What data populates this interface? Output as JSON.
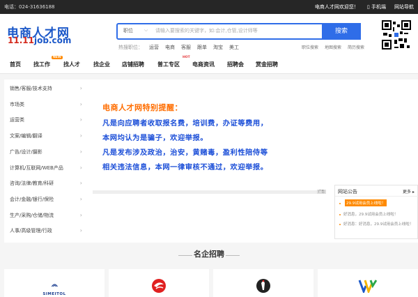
{
  "topbar": {
    "phone": "电话：024-31636188",
    "welcome": "电商人才网欢迎您！",
    "mobile": "手机端",
    "site_nav": "网站导航"
  },
  "logo": {
    "cn": "电商人才网",
    "en_red": "11.11",
    "en_blue": "job.com"
  },
  "search": {
    "type": "职位",
    "placeholder": "请输入要搜索的关键字，如:会计,仓管,设计师等",
    "button": "搜索"
  },
  "hot": {
    "label": "热搜职位：",
    "items": [
      "运营",
      "电商",
      "客服",
      "跟单",
      "淘宝",
      "美工"
    ]
  },
  "sublinks": [
    "职位搜索",
    "地图搜索",
    "简历搜索"
  ],
  "nav": {
    "items": [
      "首页",
      "找工作",
      "找人才",
      "找企业",
      "店铺招聘",
      "普工专区",
      "电商资讯",
      "招聘会",
      "赏金招聘"
    ],
    "badge_new": "NEW",
    "badge_hot": "HOT"
  },
  "categories": [
    "销售/客服/技术支持",
    "市场类",
    "运营类",
    "文案/编辑/翻译",
    "广告/设计/摄影",
    "计算机/互联网/WEB产品",
    "咨询/法律/教育/科研",
    "会计/金融/银行/保险",
    "生产/采购/仓储/物流",
    "人事/高级管理/行政"
  ],
  "notice": {
    "title": "电商人才网特别提醒：",
    "lines": [
      "凡是向应聘者收取报名费，培训费，办证等费用，",
      "本网均认为是骗子，欢迎举报。",
      "凡是发布涉及政治，治安，黄赌毒，盈利性陪侍等",
      "相关违法信息，本网一律审核不通过，欢迎举报。"
    ]
  },
  "slider_tag": "广告",
  "announcement": {
    "title": "网站公告",
    "more": "更多",
    "items": [
      "29.9试用会员上线啦！",
      "好消息，29.9试用会员上线啦！",
      "好消息：好消息，29.9试用会员上线啦！"
    ]
  },
  "section": {
    "title": "名企招聘"
  },
  "cards": [
    "SIMEITOL"
  ],
  "colors": {
    "brand_blue": "#2f6de8",
    "accent_orange": "#ff6d00",
    "notice_blue": "#1c4fd8"
  }
}
